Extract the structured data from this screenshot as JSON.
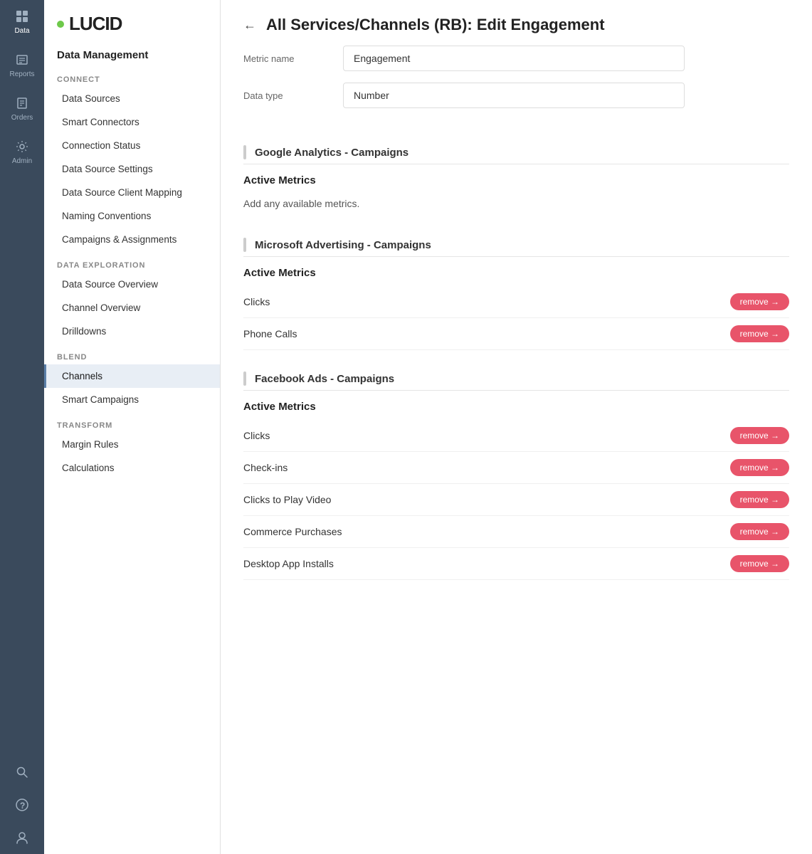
{
  "iconSidebar": {
    "items": [
      {
        "name": "data-nav-item",
        "icon": "⊞",
        "label": "Data"
      },
      {
        "name": "reports-nav-item",
        "icon": "📊",
        "label": "Reports"
      },
      {
        "name": "orders-nav-item",
        "icon": "📋",
        "label": "Orders"
      },
      {
        "name": "admin-nav-item",
        "icon": "⚙",
        "label": "Admin"
      }
    ],
    "bottomItems": [
      {
        "name": "search-nav-item",
        "icon": "🔍",
        "label": ""
      },
      {
        "name": "help-nav-item",
        "icon": "?",
        "label": ""
      },
      {
        "name": "user-nav-item",
        "icon": "👤",
        "label": ""
      }
    ]
  },
  "navSidebar": {
    "logo": "LUCID",
    "managementTitle": "Data Management",
    "sections": [
      {
        "name": "connect",
        "title": "CONNECT",
        "items": [
          {
            "label": "Data Sources",
            "active": false
          },
          {
            "label": "Smart Connectors",
            "active": false
          },
          {
            "label": "Connection Status",
            "active": false
          },
          {
            "label": "Data Source Settings",
            "active": false
          },
          {
            "label": "Data Source Client Mapping",
            "active": false
          },
          {
            "label": "Naming Conventions",
            "active": false
          },
          {
            "label": "Campaigns & Assignments",
            "active": false
          }
        ]
      },
      {
        "name": "data-exploration",
        "title": "DATA EXPLORATION",
        "items": [
          {
            "label": "Data Source Overview",
            "active": false
          },
          {
            "label": "Channel Overview",
            "active": false
          },
          {
            "label": "Drilldowns",
            "active": false
          }
        ]
      },
      {
        "name": "blend",
        "title": "BLEND",
        "items": [
          {
            "label": "Channels",
            "active": true
          },
          {
            "label": "Smart Campaigns",
            "active": false
          }
        ]
      },
      {
        "name": "transform",
        "title": "TRANSFORM",
        "items": [
          {
            "label": "Margin Rules",
            "active": false
          },
          {
            "label": "Calculations",
            "active": false
          }
        ]
      }
    ]
  },
  "page": {
    "backLabel": "←",
    "title": "All Services/Channels (RB): Edit Engagement",
    "form": {
      "metricNameLabel": "Metric name",
      "metricNameValue": "Engagement",
      "dataTypeLabel": "Data type",
      "dataTypeValue": "Number"
    },
    "dataSections": [
      {
        "id": "google-analytics",
        "sectionTitle": "Google Analytics - Campaigns",
        "activeMetricsTitle": "Active Metrics",
        "hasMetrics": false,
        "addText": "Add any available metrics.",
        "metrics": []
      },
      {
        "id": "microsoft-advertising",
        "sectionTitle": "Microsoft Advertising - Campaigns",
        "activeMetricsTitle": "Active Metrics",
        "hasMetrics": true,
        "addText": "",
        "metrics": [
          {
            "name": "Clicks"
          },
          {
            "name": "Phone Calls"
          }
        ]
      },
      {
        "id": "facebook-ads",
        "sectionTitle": "Facebook Ads - Campaigns",
        "activeMetricsTitle": "Active Metrics",
        "hasMetrics": true,
        "addText": "",
        "metrics": [
          {
            "name": "Clicks"
          },
          {
            "name": "Check-ins"
          },
          {
            "name": "Clicks to Play Video"
          },
          {
            "name": "Commerce Purchases"
          },
          {
            "name": "Desktop App Installs"
          }
        ]
      }
    ],
    "removeButtonLabel": "remove →"
  }
}
